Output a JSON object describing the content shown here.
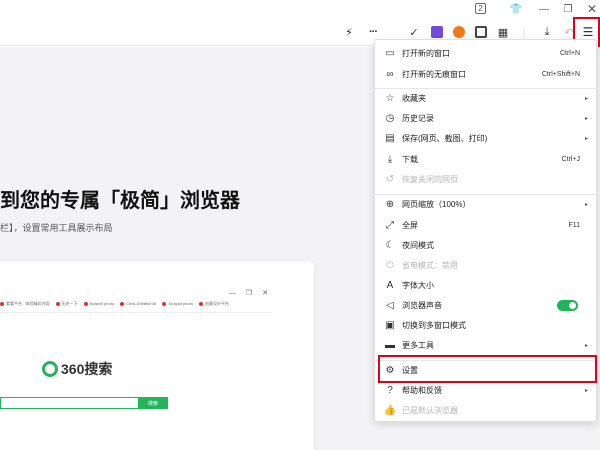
{
  "titlebar": {
    "tab_count": "2"
  },
  "page": {
    "hero_title": "到您的专属「极简」浏览器",
    "hero_subtitle": "栏】，设置常用工具展示布局",
    "preview": {
      "bookmarks": [
        "看看平台 - 体验精彩内容",
        "历史一下",
        "Snapkit photo",
        "Chris Dribbble Br",
        "Snapkit photo",
        "创意设计平台"
      ],
      "logo_text": "360搜索",
      "search_button": "搜索"
    }
  },
  "menu": {
    "items": [
      {
        "icon": "new-window-icon",
        "glyph": "▭",
        "label": "打开新的窗口",
        "shortcut": "Ctrl+N",
        "arrow": "",
        "disabled": false
      },
      {
        "icon": "incognito-icon",
        "glyph": "∞",
        "label": "打开新的无痕窗口",
        "shortcut": "Ctrl+Shift+N",
        "arrow": "",
        "disabled": false
      },
      {
        "icon": "favorites-icon",
        "glyph": "☆",
        "label": "收藏夹",
        "shortcut": "",
        "arrow": "▸",
        "disabled": false
      },
      {
        "icon": "history-icon",
        "glyph": "◷",
        "label": "历史记录",
        "shortcut": "",
        "arrow": "▸",
        "disabled": false
      },
      {
        "icon": "save-icon",
        "glyph": "▤",
        "label": "保存(网页、截图、打印)",
        "shortcut": "",
        "arrow": "▸",
        "disabled": false
      },
      {
        "icon": "download-icon",
        "glyph": "⤓",
        "label": "下载",
        "shortcut": "Ctrl+J",
        "arrow": "",
        "disabled": false
      },
      {
        "icon": "restore-closed-icon",
        "glyph": "↺",
        "label": "恢复关闭的网页",
        "shortcut": "",
        "arrow": "",
        "disabled": true
      },
      {
        "icon": "zoom-icon",
        "glyph": "⊕",
        "label": "网页缩放（100%）",
        "shortcut": "",
        "arrow": "▸",
        "disabled": false
      },
      {
        "icon": "fullscreen-icon",
        "glyph": "⤢",
        "label": "全屏",
        "shortcut": "F11",
        "arrow": "",
        "disabled": false
      },
      {
        "icon": "night-mode-icon",
        "glyph": "☾",
        "label": "夜间模式",
        "shortcut": "",
        "arrow": "",
        "disabled": false
      },
      {
        "icon": "power-save-icon",
        "glyph": "⏻",
        "label": "省电模式：禁用",
        "shortcut": "",
        "arrow": "",
        "disabled": true
      },
      {
        "icon": "font-size-icon",
        "glyph": "A",
        "label": "字体大小",
        "shortcut": "",
        "arrow": "",
        "disabled": false
      },
      {
        "icon": "sound-icon",
        "glyph": "◁",
        "label": "浏览器声音",
        "shortcut": "",
        "arrow": "",
        "disabled": false
      },
      {
        "icon": "multi-window-icon",
        "glyph": "▣",
        "label": "切换到多窗口模式",
        "shortcut": "",
        "arrow": "",
        "disabled": false
      },
      {
        "icon": "more-tools-icon",
        "glyph": "▬",
        "label": "更多工具",
        "shortcut": "",
        "arrow": "▸",
        "disabled": false
      },
      {
        "icon": "settings-icon",
        "glyph": "⚙",
        "label": "设置",
        "shortcut": "",
        "arrow": "",
        "disabled": false
      },
      {
        "icon": "help-icon",
        "glyph": "?",
        "label": "帮助和反馈",
        "shortcut": "",
        "arrow": "▸",
        "disabled": false
      },
      {
        "icon": "default-browser-icon",
        "glyph": "👍",
        "label": "已是默认浏览器",
        "shortcut": "",
        "arrow": "",
        "disabled": true
      }
    ],
    "sound_toggle_on": true
  },
  "colors": {
    "highlight_border": "#e0001b",
    "toggle_on": "#1fb45b",
    "ext_purple": "#6f4bd8",
    "ext_orange": "#f07a1a"
  }
}
